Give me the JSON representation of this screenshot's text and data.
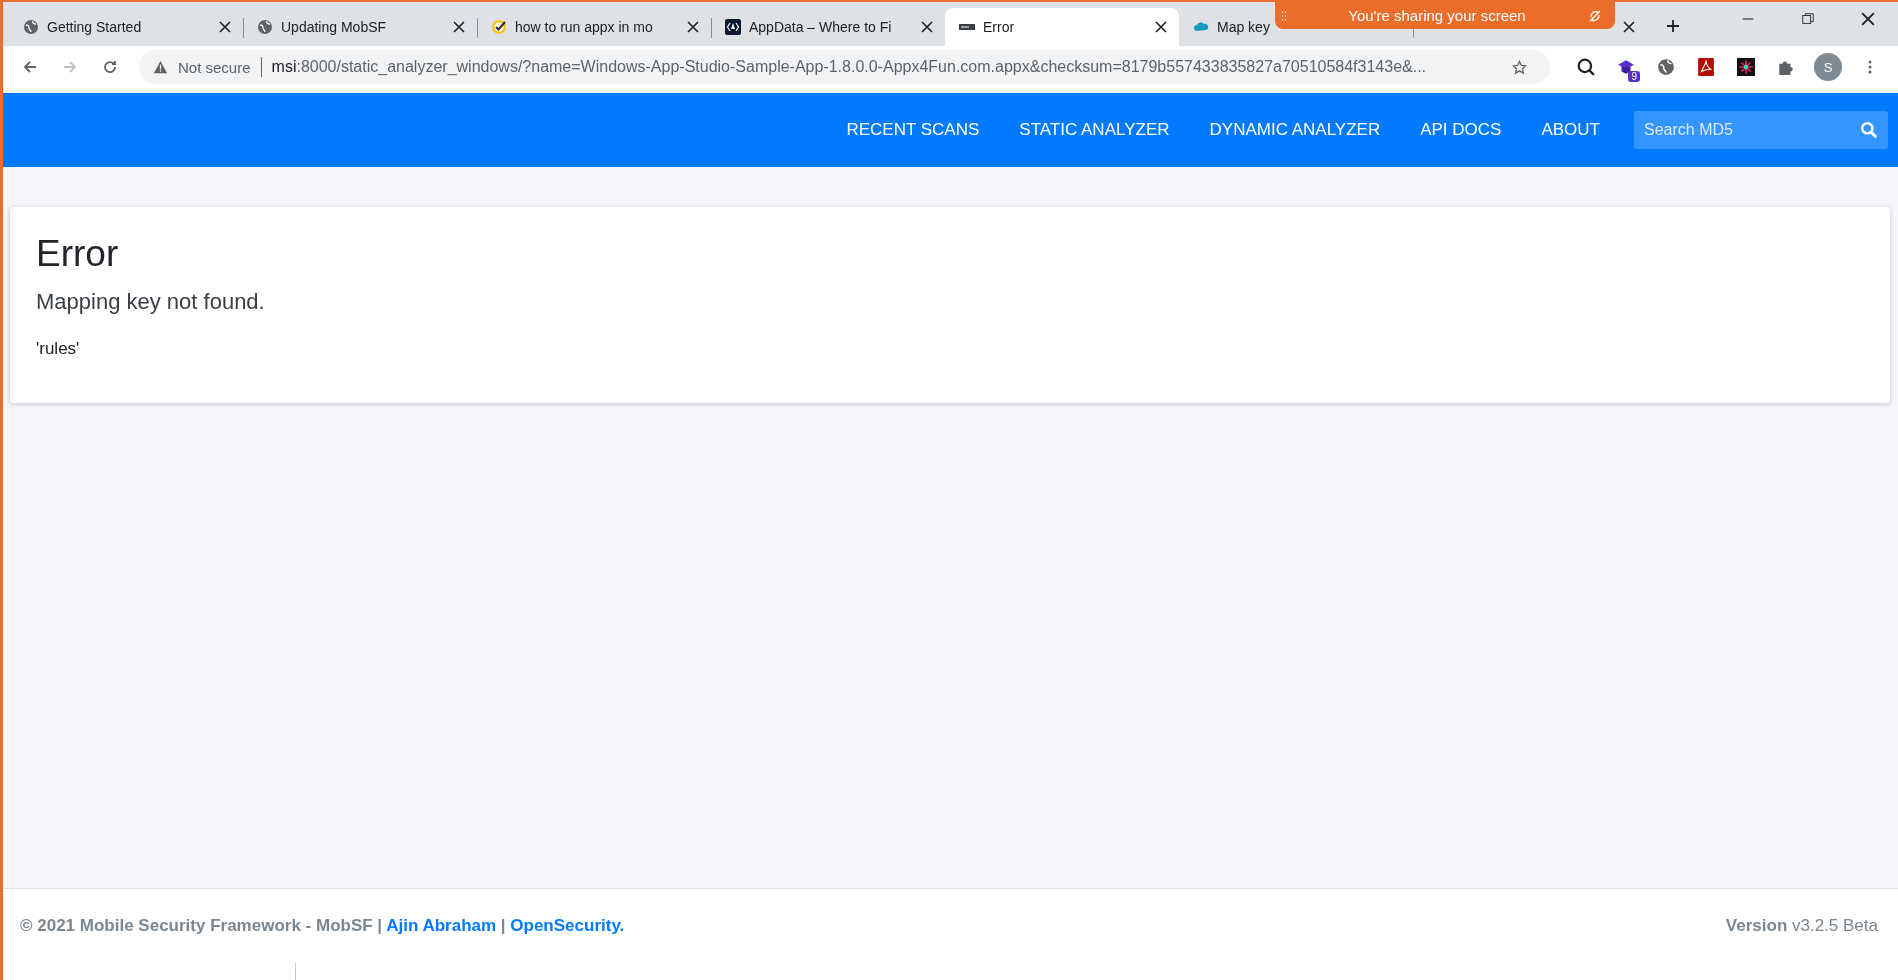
{
  "tabs": [
    {
      "title": "Getting Started",
      "selected": false
    },
    {
      "title": "Updating MobSF",
      "selected": false
    },
    {
      "title": "how to run appx in mo",
      "selected": false
    },
    {
      "title": "AppData – Where to Fi",
      "selected": false
    },
    {
      "title": "Error",
      "selected": true
    },
    {
      "title": "Map key",
      "selected": false
    },
    {
      "selected": false
    }
  ],
  "sharing_banner": {
    "text": "You're sharing your screen"
  },
  "address_bar": {
    "security": "Not secure",
    "host": "msi",
    "url_rest": ":8000/static_analyzer_windows/?name=Windows-App-Studio-Sample-App-1.8.0.0-Appx4Fun.com.appx&checksum=8179b557433835827a70510584f3143e&..."
  },
  "extension_badge": "9",
  "profile": {
    "initial": "S"
  },
  "nav": {
    "items": [
      "RECENT SCANS",
      "STATIC ANALYZER",
      "DYNAMIC ANALYZER",
      "API DOCS",
      "ABOUT"
    ],
    "search": {
      "placeholder": "Search MD5"
    }
  },
  "error": {
    "title": "Error",
    "message": "Mapping key not found.",
    "detail": "'rules'"
  },
  "footer": {
    "copyright": "© 2021 Mobile Security Framework - MobSF |",
    "author": "Ajin Abraham",
    "separator": "|",
    "org": "OpenSecurity",
    "org_suffix": ".",
    "version_label": "Version",
    "version": "v3.2.5 Beta"
  }
}
